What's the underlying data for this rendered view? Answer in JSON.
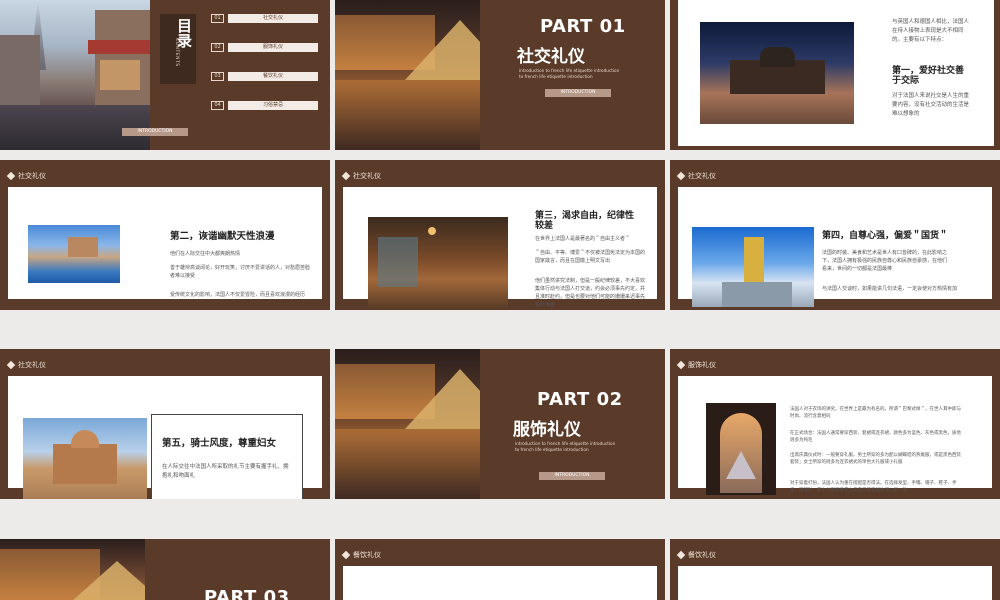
{
  "toc": {
    "title": "目录",
    "contents_label": "CONTENTS",
    "items": [
      {
        "num": "01",
        "label": "社交礼仪"
      },
      {
        "num": "02",
        "label": "服饰礼仪"
      },
      {
        "num": "03",
        "label": "餐饮礼仪"
      },
      {
        "num": "04",
        "label": "习俗禁忌"
      }
    ],
    "button": "INTRODUCTION"
  },
  "part1": {
    "num": "PART 01",
    "title": "社交礼仪",
    "sub1": "introduction to french life etiquette introduction",
    "sub2": "to french life etiquette introduction",
    "button": "INTRODUCTION"
  },
  "slide3": {
    "intro": "与英国人和德国人相比，法国人在待人接物上表现是大不相同的。主要有以下特点：",
    "heading": "第一，爱好社交善于交际",
    "body": "对于法国人来说社交是人生的重要内容，没有社交活动的生活是难以想象的"
  },
  "section_label_social": "社交礼仪",
  "slide4": {
    "heading": "第二，诙谐幽默天性浪漫",
    "p1": "他们在人际交往中大都爽朗热情",
    "p2": "善于雄辩高谈阔论，好开玩笑，讨厌不爱讲话的人，对愁眉苦脸者难以接受",
    "p3": "受传统文化的影响，法国人不仅爱冒险，而且喜欢浪漫的经历"
  },
  "slide5": {
    "heading": "第三，渴求自由，纪律性较差",
    "p1": "在世界上法国人是最著名的＂自由主义者＂",
    "p2": "＂自由、平等、博爱＂不仅被法国宪法定为本国的国家箴言，而且在国徽上明文写出",
    "p3": "他们虽然讲究法制，但是一般纪律较差，不大喜欢集体行动与法国人打交道，约会必须事先约定，并且准时赴约，但是也要对他们可能的姗姗来迟事先有所准备"
  },
  "slide6": {
    "heading": "第四，自尊心强，偏爱＂国货＂",
    "p1": "法国的时装、美食和艺术是世人有口皆碑的，在此影响之下，法国人拥有极强的民族自尊心和民族自豪感，在他们看来，世间的一切都是法国最棒",
    "p2": "与法国人交谈时，如果能讲几句法语，一定会使对方热情有加"
  },
  "slide7": {
    "heading": "第五，骑士风度，尊重妇女",
    "p1": "在人际交往中法国人所采取的礼节主要有握手礼、拥抱礼和吻面礼"
  },
  "part2": {
    "num": "PART 02",
    "title": "服饰礼仪",
    "sub1": "introduction to french life etiquette introduction",
    "sub2": "to french life etiquette introduction",
    "button": "INTRODUCTION"
  },
  "slide9": {
    "label": "服饰礼仪",
    "p1": "法国人对于衣饰的讲究，在世界上是最为有名的。所谓＂巴黎式样＂，在世人耳中即与时尚、流行含意相同",
    "p2": "在正式场合：法国人通常要穿西装、套裙或连衣裙，颜色多为蓝色、灰色或黑色，质地则多为纯毛",
    "p3": "出席庆典仪式时：一般要穿礼服。男士所穿的多为配以蝴蝶结的燕尾服，或是黑色西装套装；女士所穿的则多为连衣裙式的单色大礼服或小礼服",
    "p4": "对于穿着打扮，法国人认为重在搭配是否得法。在选择发型、手镯、帽子、鞋子、手表、眼镜时，都十分强调要使之与自己着装相协调，相一致"
  },
  "part3": {
    "num": "PART 03"
  },
  "section_label_dining": "餐饮礼仪"
}
